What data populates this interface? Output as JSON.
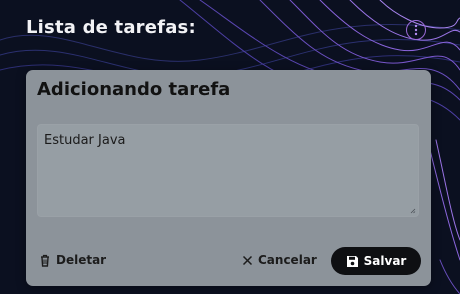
{
  "header": {
    "title": "Lista de tarefas:"
  },
  "card": {
    "title": "Adicionando tarefa",
    "task_value": "Estudar Java"
  },
  "actions": {
    "delete_label": "Deletar",
    "cancel_label": "Cancelar",
    "save_label": "Salvar"
  },
  "icons": {
    "menu": "kebab-menu-icon",
    "delete": "trash-icon",
    "cancel": "close-icon",
    "save": "floppy-disk-icon"
  },
  "colors": {
    "background": "#0b1020",
    "accent": "#9b6ad8",
    "card": "#8c939a",
    "save_button": "#0e0f12"
  }
}
